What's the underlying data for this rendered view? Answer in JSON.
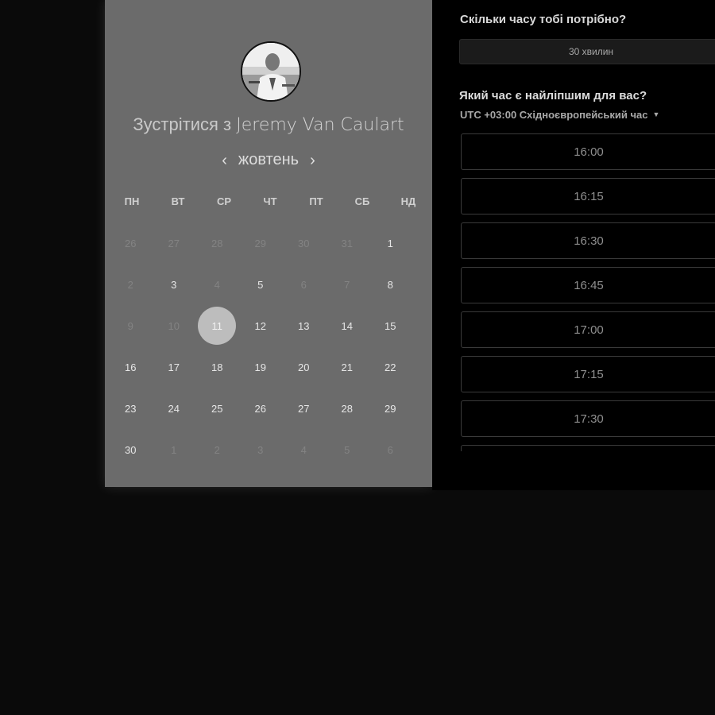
{
  "meeting": {
    "title_prefix": "Зустрітися з",
    "host_name": "Jeremy Van Caulart"
  },
  "calendar": {
    "month": "жовтень",
    "prev_label": "‹",
    "next_label": "›",
    "weekdays": [
      "ПН",
      "ВТ",
      "СР",
      "ЧТ",
      "ПТ",
      "СБ",
      "НД"
    ],
    "weeks": [
      [
        {
          "d": "26",
          "muted": true
        },
        {
          "d": "27",
          "muted": true
        },
        {
          "d": "28",
          "muted": true
        },
        {
          "d": "29",
          "muted": true
        },
        {
          "d": "30",
          "muted": true
        },
        {
          "d": "31",
          "muted": true
        },
        {
          "d": "1",
          "muted": false
        }
      ],
      [
        {
          "d": "2",
          "muted": true
        },
        {
          "d": "3",
          "muted": false
        },
        {
          "d": "4",
          "muted": true
        },
        {
          "d": "5",
          "muted": false
        },
        {
          "d": "6",
          "muted": true
        },
        {
          "d": "7",
          "muted": true
        },
        {
          "d": "8",
          "muted": false
        }
      ],
      [
        {
          "d": "9",
          "muted": true
        },
        {
          "d": "10",
          "muted": true
        },
        {
          "d": "11",
          "muted": false,
          "selected": true
        },
        {
          "d": "12",
          "muted": false
        },
        {
          "d": "13",
          "muted": false
        },
        {
          "d": "14",
          "muted": false
        },
        {
          "d": "15",
          "muted": false
        }
      ],
      [
        {
          "d": "16",
          "muted": false
        },
        {
          "d": "17",
          "muted": false
        },
        {
          "d": "18",
          "muted": false
        },
        {
          "d": "19",
          "muted": false
        },
        {
          "d": "20",
          "muted": false
        },
        {
          "d": "21",
          "muted": false
        },
        {
          "d": "22",
          "muted": false
        }
      ],
      [
        {
          "d": "23",
          "muted": false
        },
        {
          "d": "24",
          "muted": false
        },
        {
          "d": "25",
          "muted": false
        },
        {
          "d": "26",
          "muted": false
        },
        {
          "d": "27",
          "muted": false
        },
        {
          "d": "28",
          "muted": false
        },
        {
          "d": "29",
          "muted": false
        }
      ],
      [
        {
          "d": "30",
          "muted": false
        },
        {
          "d": "1",
          "muted": true
        },
        {
          "d": "2",
          "muted": true
        },
        {
          "d": "3",
          "muted": true
        },
        {
          "d": "4",
          "muted": true
        },
        {
          "d": "5",
          "muted": true
        },
        {
          "d": "6",
          "muted": true
        }
      ]
    ]
  },
  "booking": {
    "duration_question": "Скільки часу тобі потрібно?",
    "duration_value": "30 хвилин",
    "time_question": "Який час є найліпшим для вас?",
    "timezone": "UTC +03:00 Східноєвропейський час",
    "slots": [
      "16:00",
      "16:15",
      "16:30",
      "16:45",
      "17:00",
      "17:15",
      "17:30",
      ""
    ]
  }
}
